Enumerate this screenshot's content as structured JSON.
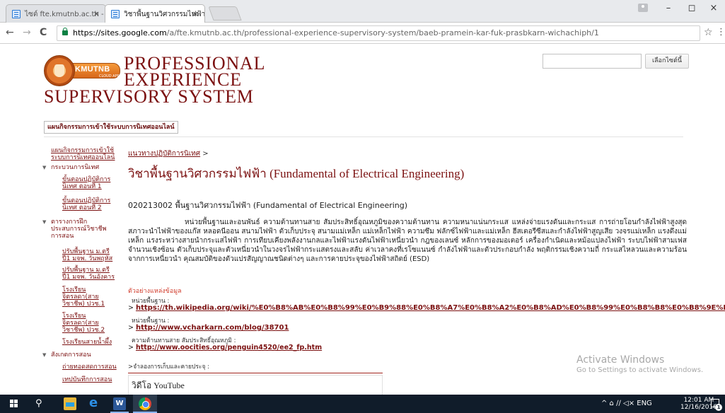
{
  "browser": {
    "tabs": [
      {
        "label": "ไซต์ fte.kmutnb.ac.th - Go",
        "close": "×"
      },
      {
        "label": "วิชาพื้นฐานวิศวกรรมไฟฟ้า (F",
        "close": "×"
      }
    ],
    "window_controls": {
      "minimize": "–",
      "maximize": "◻",
      "close": "×"
    },
    "nav": {
      "back": "←",
      "forward": "→",
      "reload": "C"
    },
    "url_host": "https://sites.google.com",
    "url_path": "/a/fte.kmutnb.ac.th/professional-experience-supervisory-system/baeb-pramein-kar-fuk-prasbkarn-wichachiph/1",
    "star": "☆",
    "menu": "⋮"
  },
  "site": {
    "logo_text": "KMUTNB",
    "logo_sub": "CLOUD APP",
    "title_lines": [
      "PROFESSIONAL",
      "EXPERIENCE",
      "SUPERVISORY SYSTEM"
    ],
    "search_button": "เลือกไซต์นี้",
    "top_nav_button": "แผนกิจกรรมการเข้าใช้ระบบการนิเทศออนไลน์"
  },
  "sidebar": {
    "items": [
      {
        "label_lines": [
          "แผนกิจกรรมการเข้าใช้",
          "ระบบการนิเทศออนไลน์"
        ]
      },
      {
        "label_lines": [
          "กระบวนการนิเทศ"
        ],
        "arrow": "▼"
      },
      {
        "label_lines": [
          "ขั้นตอนปฏิบัติการ",
          "นิเทศ ตอนที่ 1"
        ]
      },
      {
        "label_lines": [
          "ขั้นตอนปฏิบัติการ",
          "นิเทศ ตอนที่ 2"
        ]
      },
      {
        "label_lines": [
          "ตารางการฝึก",
          "ประสบการณ์วิชาชีพ",
          "การสอน"
        ],
        "arrow": "▼"
      },
      {
        "label_lines": [
          "ปรับพื้นฐาน ม.ตรี",
          "ปี1 มจพ. วันพฤหัส"
        ]
      },
      {
        "label_lines": [
          "ปรับพื้นฐาน ม.ตรี",
          "ปี1 มจพ. วันอังคาร"
        ]
      },
      {
        "label_lines": [
          "โรงเรียน",
          "จิตรลดา(สาย",
          "วิชาชีพ) ปวช.1"
        ]
      },
      {
        "label_lines": [
          "โรงเรียน",
          "จิตรลดา(สาย",
          "วิชาชีพ) ปวช.2"
        ]
      },
      {
        "label_lines": [
          "โรงเรียนสายน้ำผึ้ง"
        ]
      },
      {
        "label_lines": [
          "สังเกตการสอน"
        ],
        "arrow": "▼"
      },
      {
        "label_lines": [
          "ถ่ายทอดสดการสอน"
        ]
      },
      {
        "label_lines": [
          "เทปบันทึกการสอน"
        ]
      }
    ]
  },
  "content": {
    "breadcrumb_link": "แนวทางปฏิบัติการนิเทศ",
    "breadcrumb_sep": " >",
    "heading": "วิชาพื้นฐานวิศวกรรมไฟฟ้า (Fundamental of Electrical Engineering)",
    "course_line": "020213002    พื้นฐานวิศวกรรมไฟฟ้า (Fundamental of Electrical Engineering)",
    "description": "หน่วยพื้นฐานและอนพันธ์ ความต้านทานสาย สัมประสิทธิ์อุณหภูมิของความต้านทาน ความหนาแน่นกระแส แหล่งจ่ายแรงดันและกระแส การถ่ายโอนกำลังไฟฟ้าสูงสุด สภาวะนำไฟฟ้าของแก๊ส หลอดนีออน สนามไฟฟ้า ตัวเก็บประจุ สนามแม่เหล็ก แม่เหล็กไฟฟ้า ความซึม ฟลักซ์ไฟฟ้าและแม่เหล็ก ฮีสเตอรีซีสและกำลังไฟฟ้าสูญเสีย วงจรแม่เหล็ก แรงดึงแม่เหล็ก แรงระหว่างสายนำกระแสไฟฟ้า การเทียบเคียงพลังงานกลและไฟฟ้าแรงดันไฟฟ้าเหนี่ยวนำ กฎของเลนซ์ หลักการของมอเตอร์ เครื่องกำเนิดและหม้อแปลงไฟฟ้า ระบบไฟฟ้าสามเฟส จำนวนเชิงซ้อน ตัวเก็บประจุและตัวเหนี่ยวนำในวงจรไฟฟ้ากระแสตรงและสลับ ค่าเวลาคงที่เรโซแนนซ์ กำลังไฟฟ้าและตัวประกอบกำลัง พฤติกรรมเชิงความถี่ กระแสไหลวนและความร้อนจากการเหนี่ยวนำ คุณสมบัติของตัวแปรสัญญาณชนิดต่างๆ และการคายประจุของไฟฟ้าสถิตย์ (ESD)",
    "refs_heading": "ตัวอย่างแหล่งข้อมูล",
    "refs": [
      {
        "label": "หน่วยพื้นฐาน :",
        "prefix": "> ",
        "url": "https://th.wikipedia.org/wiki/%E0%B8%AB%E0%B8%99%E0%B9%88%E0%B8%A7%E0%B8%A2%E0%B8%AD%E0%B8%99%E0%B8%B8%E0%B8%9E%E0%B8%B1%9"
      },
      {
        "label": "หน่วยพื้นฐาน :",
        "prefix": "> ",
        "url": "http://www.vcharkarn.com/blog/38701"
      },
      {
        "label": "ความต้านทานสาย สัมประสิทธิ์อุณหภูมิ :",
        "prefix": "> ",
        "url": "http://www.oocities.org/penguin4520/ee2_fp.htm"
      }
    ],
    "sub_note": ">จำลองการเก็บและคายประจุ :",
    "youtube_title": "วิดีโอ YouTube"
  },
  "watermark": {
    "line1": "Activate Windows",
    "line2": "Go to Settings to activate Windows."
  },
  "taskbar": {
    "search_glyph": "⚲",
    "word_label": "W",
    "tray_text": "^  ⌂  ∕∕  ◁×  ENG",
    "time": "12:01 AM",
    "date": "12/16/2016",
    "notif_count": "1"
  }
}
